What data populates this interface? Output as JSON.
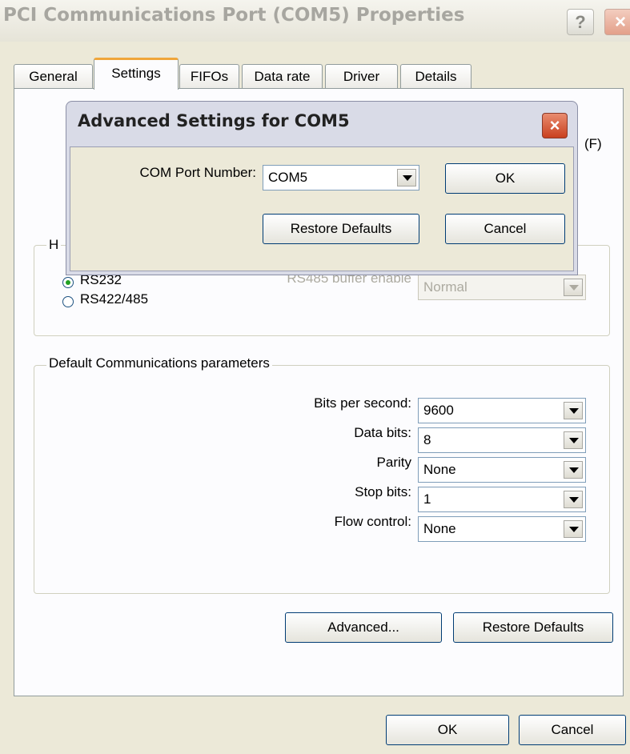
{
  "window": {
    "title": "PCI Communications Port (COM5) Properties",
    "help_label": "?",
    "close_label": "×"
  },
  "tabs": [
    {
      "label": "General"
    },
    {
      "label": "Settings"
    },
    {
      "label": "FIFOs"
    },
    {
      "label": "Data rate"
    },
    {
      "label": "Driver"
    },
    {
      "label": "Details"
    }
  ],
  "settings": {
    "hardware_group_partial": "H",
    "partial_label_f": "(F)",
    "rs232_label": "RS232",
    "rs422_label": "RS422/485",
    "selected_mode": "RS232",
    "rs485_buffer_label": "RS485 buffer enable",
    "rs485_buffer_value": "Normal",
    "defaults_group_label": "Default Communications parameters",
    "bits_per_second_label": "Bits per second:",
    "bits_per_second_value": "9600",
    "data_bits_label": "Data bits:",
    "data_bits_value": "8",
    "parity_label": "Parity",
    "parity_value": "None",
    "stop_bits_label": "Stop bits:",
    "stop_bits_value": "1",
    "flow_control_label": "Flow control:",
    "flow_control_value": "None",
    "advanced_label": "Advanced...",
    "restore_defaults_label": "Restore Defaults"
  },
  "footer": {
    "ok_label": "OK",
    "cancel_label": "Cancel"
  },
  "advanced_dialog": {
    "title": "Advanced Settings for COM5",
    "close_label": "×",
    "com_port_label": "COM Port Number:",
    "com_port_value": "COM5",
    "ok_label": "OK",
    "restore_defaults_label": "Restore Defaults",
    "cancel_label": "Cancel"
  },
  "colors": {
    "active_tab_accent": "#f0a63a",
    "close_button": "#c9401f",
    "dialog_face": "#ece9d8"
  }
}
